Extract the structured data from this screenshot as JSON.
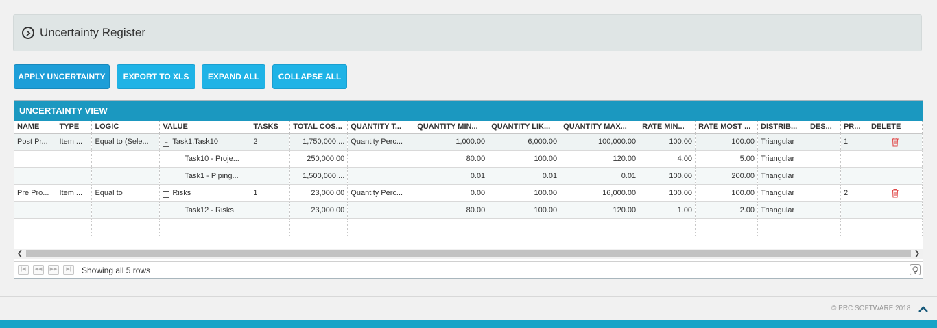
{
  "header": {
    "title": "Uncertainty Register"
  },
  "toolbar": {
    "apply_label": "APPLY UNCERTAINTY",
    "export_label": "EXPORT TO XLS",
    "expand_label": "EXPAND ALL",
    "collapse_label": "COLLAPSE ALL"
  },
  "grid": {
    "title": "UNCERTAINTY VIEW",
    "columns": [
      "NAME",
      "TYPE",
      "LOGIC",
      "VALUE",
      "TASKS",
      "TOTAL COS...",
      "QUANTITY T...",
      "QUANTITY MIN...",
      "QUANTITY LIK...",
      "QUANTITY MAX...",
      "RATE MIN...",
      "RATE MOST ...",
      "DISTRIB...",
      "DES...",
      "PR...",
      "DELETE"
    ],
    "rows": [
      {
        "kind": "parent",
        "name": "Post Pr...",
        "type": "Item ...",
        "logic": "Equal to (Sele...",
        "value": "Task1,Task10",
        "tasks": "2",
        "total_cost": "1,750,000....",
        "quantity_type": "Quantity Perc...",
        "qmin": "1,000.00",
        "qlik": "6,000.00",
        "qmax": "100,000.00",
        "rmin": "100.00",
        "rmost": "100.00",
        "distrib": "Triangular",
        "des": "",
        "pr": "1"
      },
      {
        "kind": "child",
        "name": "",
        "type": "",
        "logic": "",
        "value": "Task10 - Proje...",
        "tasks": "",
        "total_cost": "250,000.00",
        "quantity_type": "",
        "qmin": "80.00",
        "qlik": "100.00",
        "qmax": "120.00",
        "rmin": "4.00",
        "rmost": "5.00",
        "distrib": "Triangular",
        "des": "",
        "pr": ""
      },
      {
        "kind": "child",
        "name": "",
        "type": "",
        "logic": "",
        "value": "Task1 - Piping...",
        "tasks": "",
        "total_cost": "1,500,000....",
        "quantity_type": "",
        "qmin": "0.01",
        "qlik": "0.01",
        "qmax": "0.01",
        "rmin": "100.00",
        "rmost": "200.00",
        "distrib": "Triangular",
        "des": "",
        "pr": ""
      },
      {
        "kind": "parent",
        "name": "Pre Pro...",
        "type": "Item ...",
        "logic": "Equal to",
        "value": "Risks",
        "tasks": "1",
        "total_cost": "23,000.00",
        "quantity_type": "Quantity Perc...",
        "qmin": "0.00",
        "qlik": "100.00",
        "qmax": "16,000.00",
        "rmin": "100.00",
        "rmost": "100.00",
        "distrib": "Triangular",
        "des": "",
        "pr": "2"
      },
      {
        "kind": "child",
        "name": "",
        "type": "",
        "logic": "",
        "value": "Task12 - Risks",
        "tasks": "",
        "total_cost": "23,000.00",
        "quantity_type": "",
        "qmin": "80.00",
        "qlik": "100.00",
        "qmax": "120.00",
        "rmin": "1.00",
        "rmost": "2.00",
        "distrib": "Triangular",
        "des": "",
        "pr": ""
      }
    ]
  },
  "pager": {
    "status": "Showing all 5 rows"
  },
  "footer": {
    "copyright": "© PRC SOFTWARE 2018"
  },
  "colors": {
    "accent": "#1fb3e6",
    "grid_header": "#1b98c0",
    "delete_icon": "#e04848",
    "bottom_bar": "#17a4c7"
  }
}
